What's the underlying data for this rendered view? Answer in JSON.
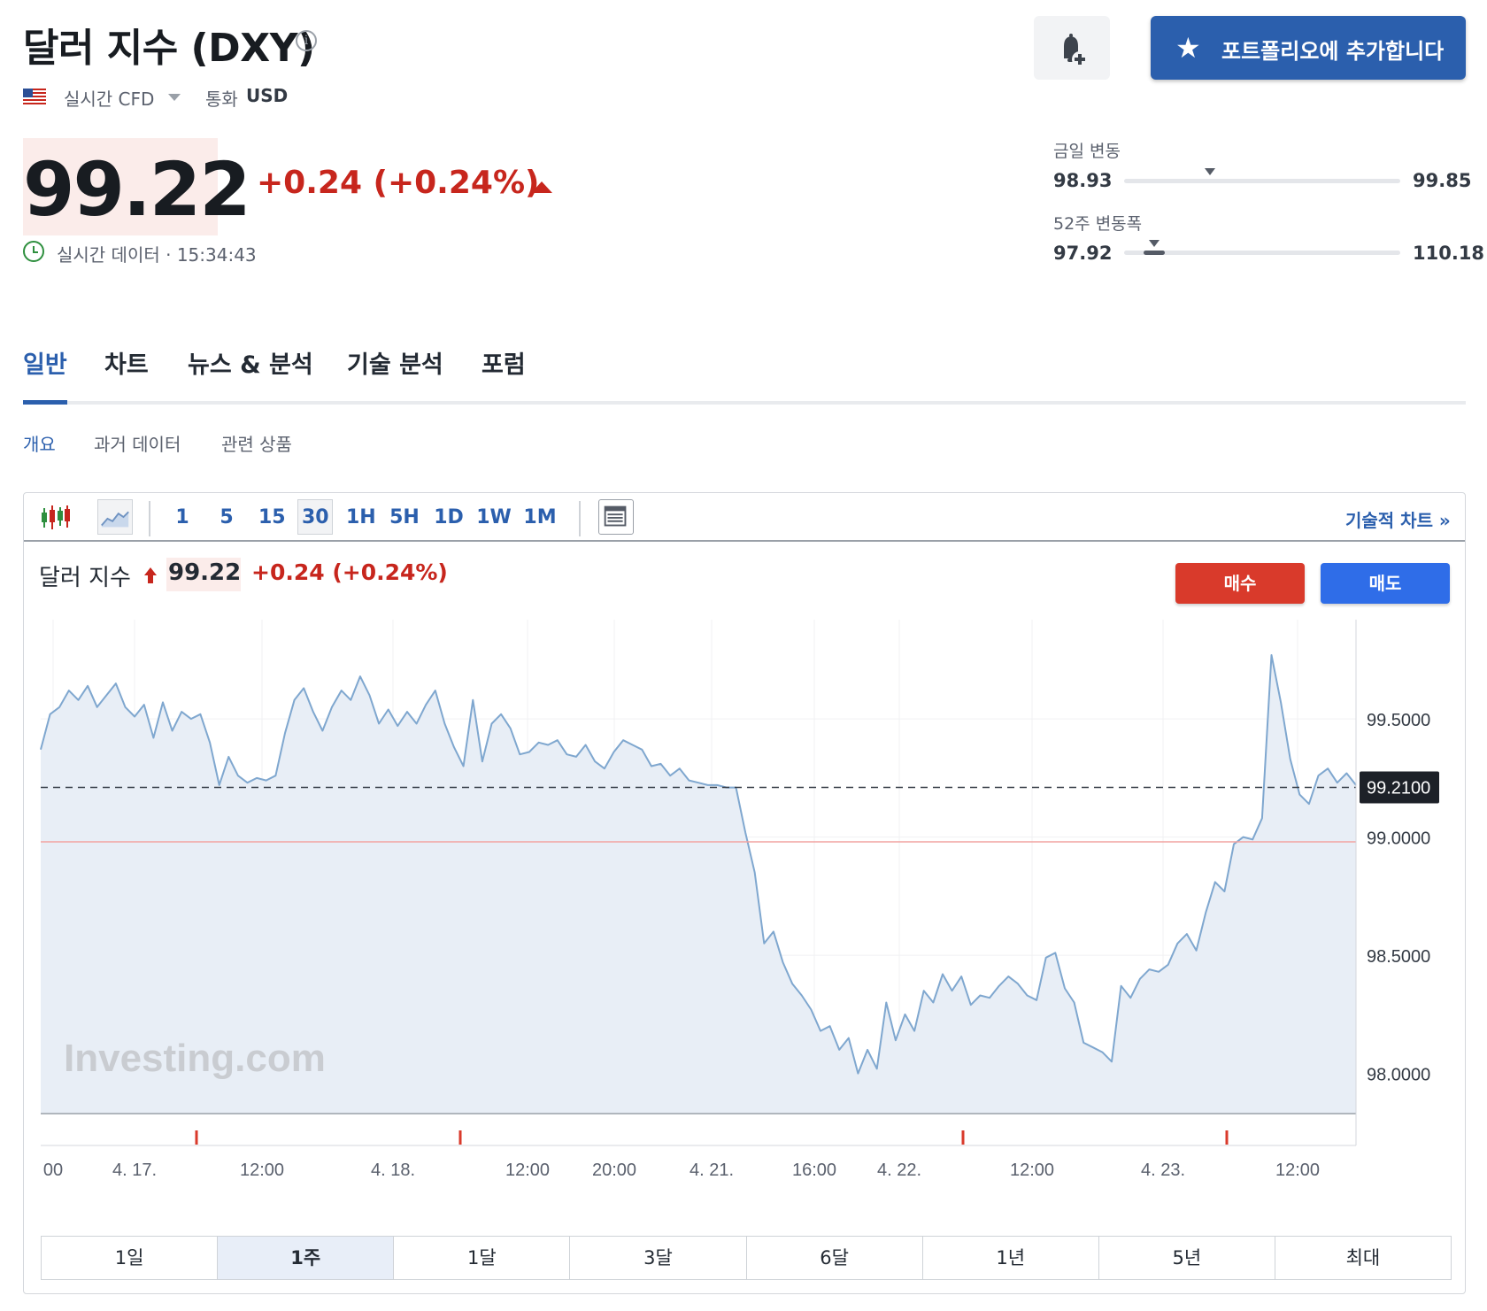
{
  "header": {
    "title": "달러 지수 (DXY)",
    "realtime_cfd": "실시간 CFD",
    "currency_label": "통화",
    "currency_value": "USD",
    "portfolio_button": "포트폴리오에 추가합니다",
    "brand_color": "#2b5fad"
  },
  "quote": {
    "price": "99.22",
    "change": "+0.24 (+0.24%)",
    "realtime_time": "실시간 데이터 · 15:34:43",
    "up_color": "#c7261d"
  },
  "ranges": {
    "day": {
      "label": "금일 변동",
      "low": "98.93",
      "high": "99.85",
      "position": 0.31
    },
    "week52": {
      "label": "52주 변동폭",
      "low": "97.92",
      "high": "110.18",
      "position": 0.11
    }
  },
  "tabs": [
    {
      "label": "일반"
    },
    {
      "label": "차트"
    },
    {
      "label": "뉴스 & 분석"
    },
    {
      "label": "기술 분석"
    },
    {
      "label": "포럼"
    }
  ],
  "subtabs": [
    {
      "label": "개요"
    },
    {
      "label": "과거 데이터"
    },
    {
      "label": "관련 상품"
    }
  ],
  "toolbar": {
    "timeframes": [
      "1",
      "5",
      "15",
      "30",
      "1H",
      "5H",
      "1D",
      "1W",
      "1M"
    ],
    "selected_timeframe": "30",
    "tech_chart_link": "기술적 차트 »"
  },
  "chart_header": {
    "name": "달러 지수",
    "price": "99.22",
    "change": "+0.24 (+0.24%)",
    "buy": "매수",
    "sell": "매도"
  },
  "chart_data": {
    "type": "area",
    "ylim": [
      97.83,
      99.92
    ],
    "yticks": [
      "99.5000",
      "99.0000",
      "98.5000",
      "98.0000"
    ],
    "ytick_values": [
      99.5,
      99.0,
      98.5,
      98.0
    ],
    "current_label": "99.2100",
    "current_value": 99.21,
    "reference_value": 98.98,
    "xlabels": [
      "00",
      "4. 17.",
      "12:00",
      "4. 18.",
      "12:00",
      "20:00",
      "4. 21.",
      "16:00",
      "4. 22.",
      "12:00",
      "4. 23.",
      "12:00"
    ],
    "watermark": "Investing.com",
    "values": [
      99.37,
      99.52,
      99.55,
      99.62,
      99.58,
      99.64,
      99.55,
      99.6,
      99.65,
      99.55,
      99.51,
      99.56,
      99.42,
      99.57,
      99.45,
      99.53,
      99.5,
      99.52,
      99.4,
      99.22,
      99.34,
      99.26,
      99.23,
      99.25,
      99.24,
      99.26,
      99.44,
      99.58,
      99.63,
      99.53,
      99.45,
      99.55,
      99.62,
      99.58,
      99.68,
      99.6,
      99.48,
      99.54,
      99.47,
      99.53,
      99.48,
      99.56,
      99.62,
      99.48,
      99.38,
      99.3,
      99.58,
      99.32,
      99.48,
      99.52,
      99.46,
      99.35,
      99.36,
      99.4,
      99.39,
      99.41,
      99.35,
      99.34,
      99.39,
      99.32,
      99.29,
      99.36,
      99.41,
      99.39,
      99.37,
      99.3,
      99.31,
      99.26,
      99.29,
      99.24,
      99.23,
      99.22,
      99.22,
      99.21,
      99.21,
      99.02,
      98.85,
      98.55,
      98.6,
      98.47,
      98.38,
      98.33,
      98.27,
      98.18,
      98.2,
      98.1,
      98.15,
      98.0,
      98.1,
      98.02,
      98.3,
      98.14,
      98.25,
      98.18,
      98.35,
      98.3,
      98.42,
      98.35,
      98.41,
      98.29,
      98.33,
      98.32,
      98.37,
      98.41,
      98.38,
      98.33,
      98.31,
      98.49,
      98.51,
      98.36,
      98.3,
      98.13,
      98.11,
      98.09,
      98.05,
      98.37,
      98.32,
      98.4,
      98.44,
      98.43,
      98.46,
      98.55,
      98.59,
      98.52,
      98.68,
      98.81,
      98.77,
      98.97,
      99.0,
      98.99,
      99.08,
      99.77,
      99.57,
      99.33,
      99.18,
      99.14,
      99.26,
      99.29,
      99.23,
      99.27,
      99.22
    ],
    "xlim": [
      0,
      140
    ],
    "plot_color": "#7fa7cf",
    "fill_color": "#e8eef6"
  },
  "periods": {
    "items": [
      "1일",
      "1주",
      "1달",
      "3달",
      "6달",
      "1년",
      "5년",
      "최대"
    ],
    "active": "1주"
  }
}
